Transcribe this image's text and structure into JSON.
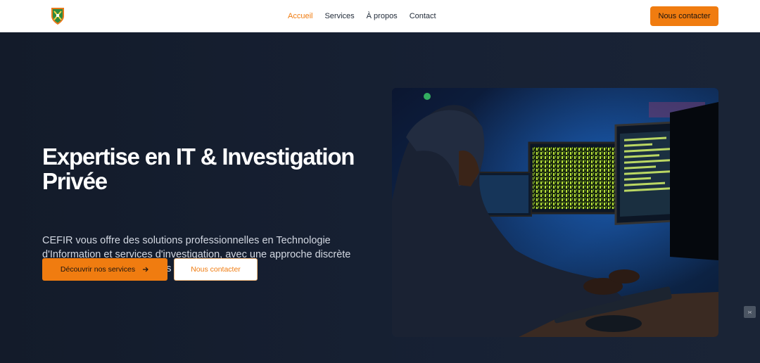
{
  "header": {
    "logo_icon": "shield-logo-icon",
    "nav": [
      {
        "label": "Accueil",
        "active": true
      },
      {
        "label": "Services",
        "active": false
      },
      {
        "label": "À propos",
        "active": false
      },
      {
        "label": "Contact",
        "active": false
      }
    ],
    "cta_label": "Nous contacter"
  },
  "hero": {
    "title": "Expertise en IT & Investigation Privée",
    "description": "CEFIR vous offre des solutions professionnelles en Technologie d'Information et services d'investigation, avec une approche discrète et efficace pour protéger vos intérêts.",
    "primary_button": {
      "label": "Découvrir nos services",
      "icon": "arrow-right-icon"
    },
    "secondary_button": {
      "label": "Nous contacter"
    },
    "image_icon": "hooded-hacker-at-computers-photo"
  },
  "side_widget": {
    "icon": "code-icon",
    "glyph": "›‹"
  },
  "colors": {
    "accent": "#f07c10",
    "hero_background": "#141c2b",
    "nav_background": "#ffffff",
    "nav_text": "#1f2937",
    "hero_text": "#d3d8e2"
  }
}
